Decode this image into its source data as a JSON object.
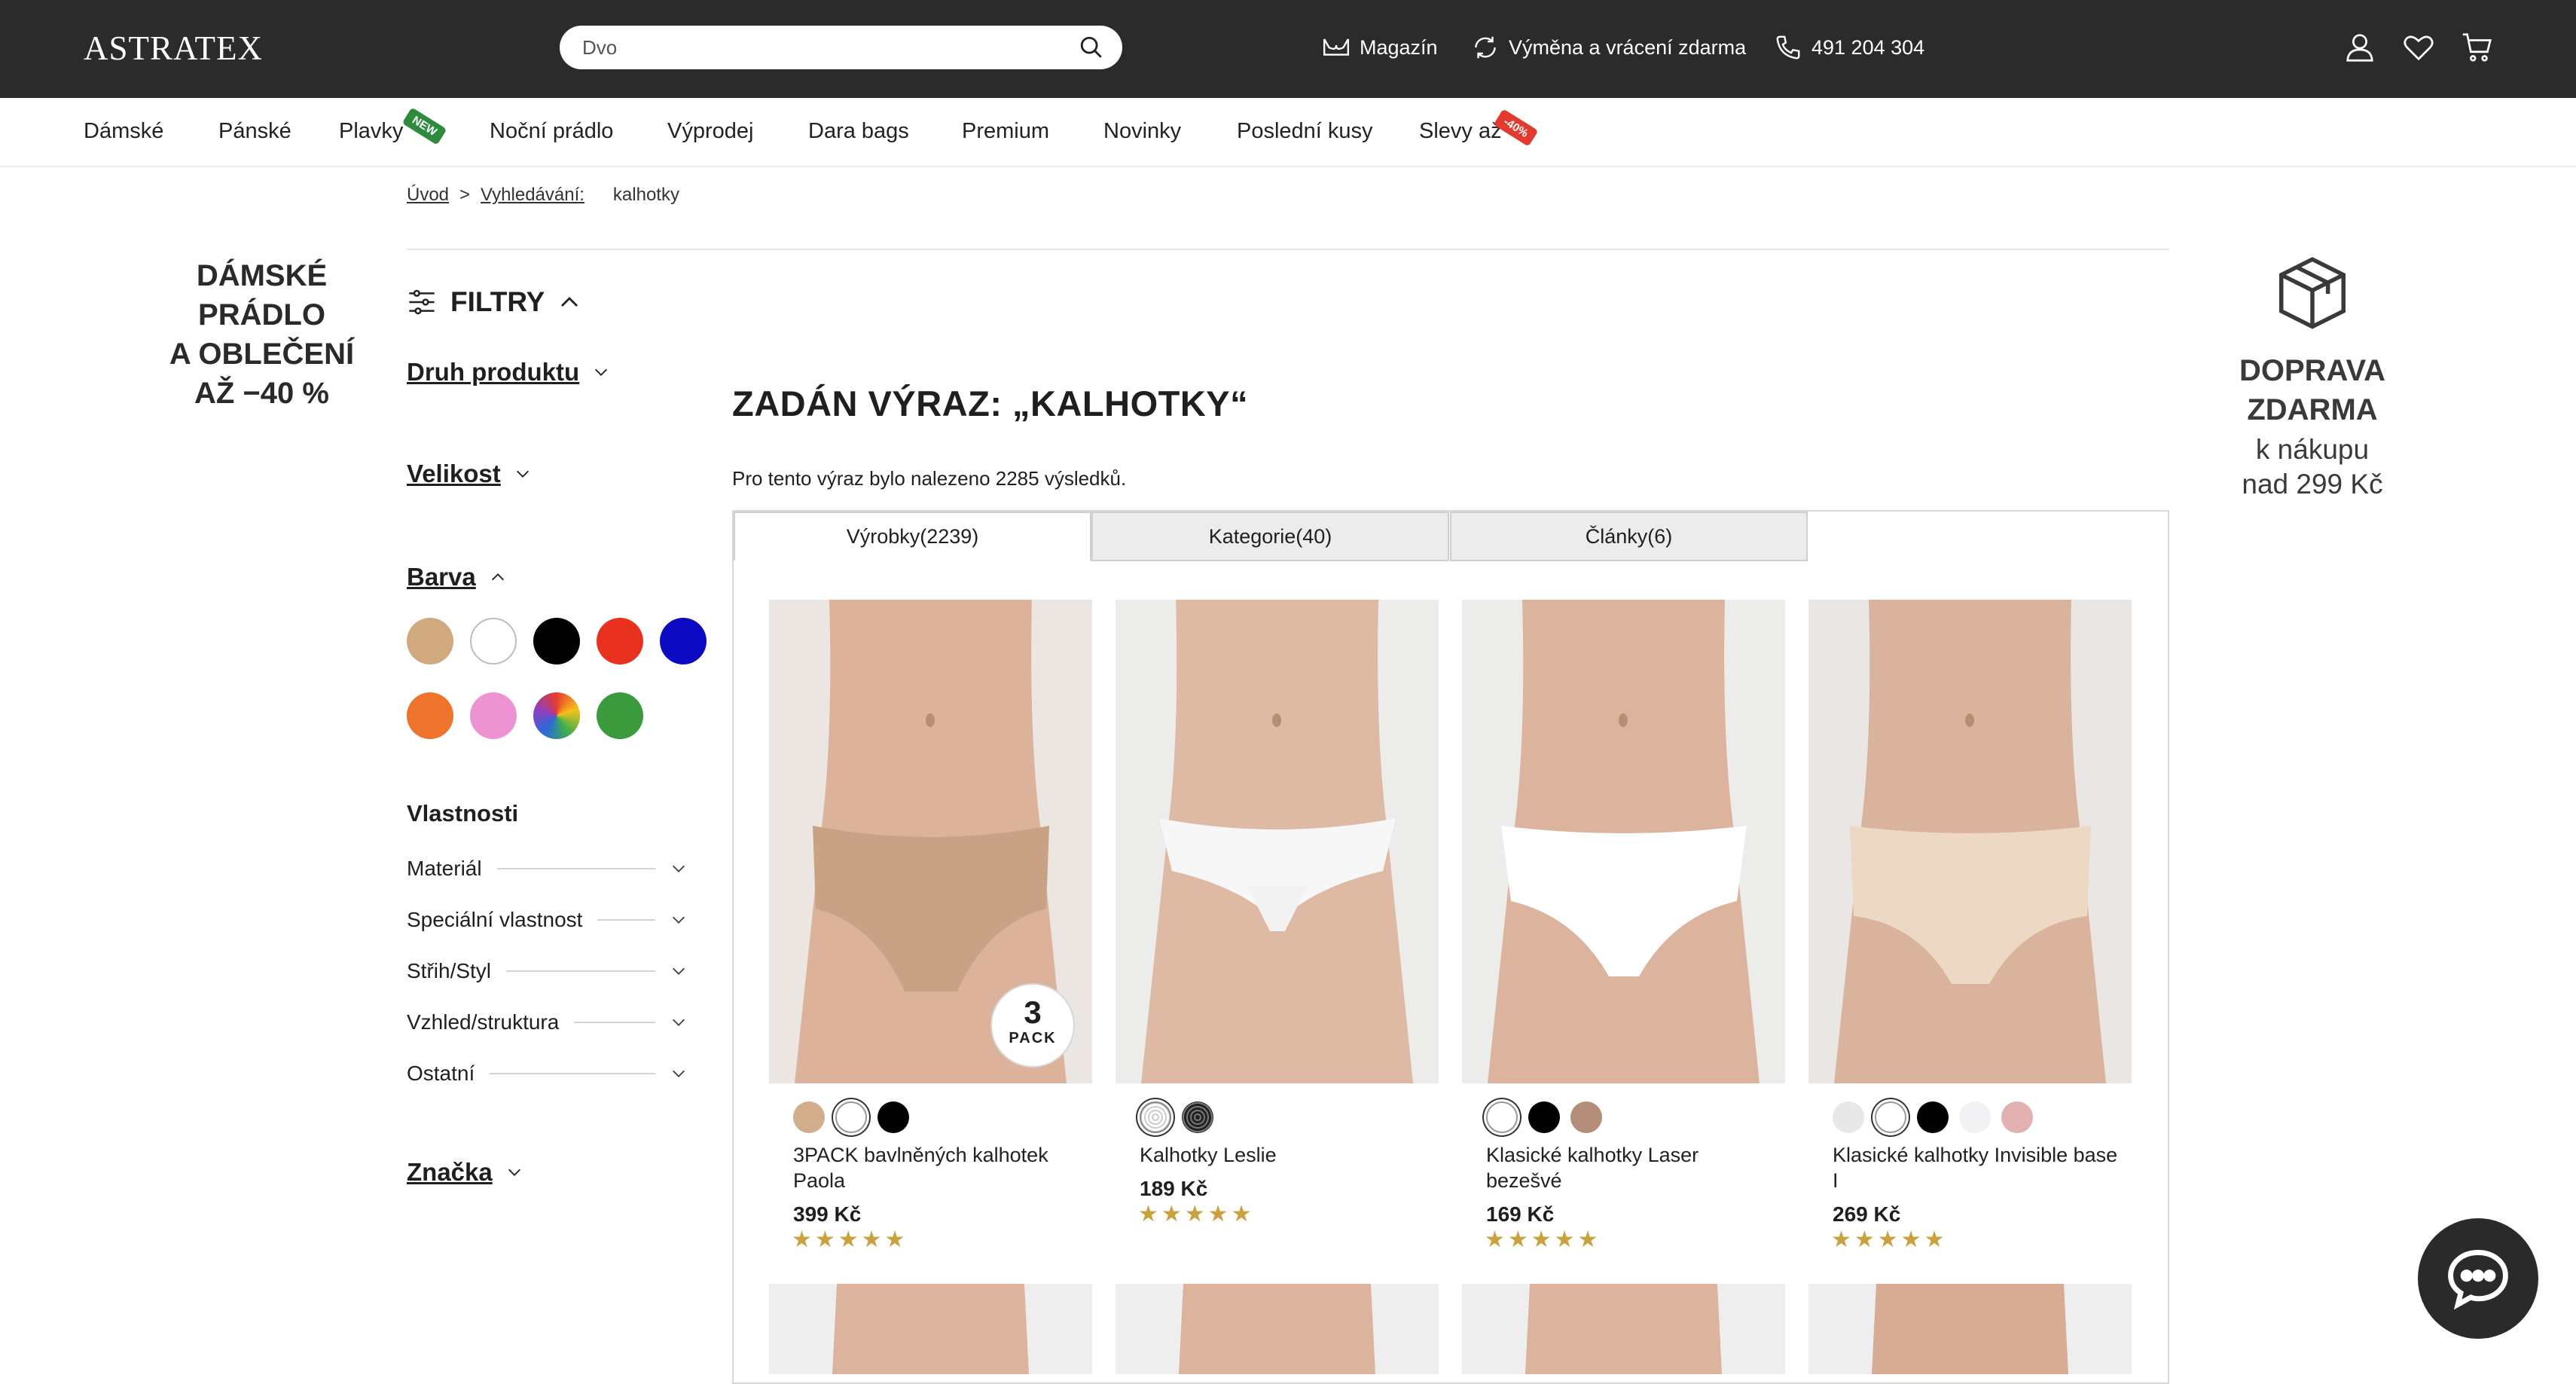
{
  "header": {
    "logo": "ASTRATEX",
    "search": {
      "value": "Dvo"
    },
    "links": [
      {
        "label": "Magazín",
        "icon": "bra-icon"
      },
      {
        "label": "Výměna a vrácení zdarma",
        "icon": "refresh-icon"
      },
      {
        "label": "491 204 304",
        "icon": "phone-icon"
      }
    ],
    "icons": [
      "account-icon",
      "heart-icon",
      "cart-icon"
    ]
  },
  "nav": {
    "items": [
      "Dámské",
      "Pánské",
      "Plavky",
      "Noční prádlo",
      "Výprodej",
      "Dara bags",
      "Premium",
      "Novinky",
      "Poslední kusy",
      "Slevy až"
    ],
    "new_badge": "NEW",
    "sale_badge": "-40%"
  },
  "breadcrumb": {
    "home": "Úvod",
    "sep": ">",
    "search": "Vyhledávání:",
    "current": "kalhotky"
  },
  "promo_left": {
    "lines": [
      "DÁMSKÉ",
      "PRÁDLO",
      "A OBLEČENÍ",
      "AŽ −40 %"
    ]
  },
  "promo_right": {
    "title_1": "DOPRAVA",
    "title_2": "ZDARMA",
    "sub_1": "k nákupu",
    "sub_2": "nad 299 Kč"
  },
  "filters": {
    "title": "FILTRY",
    "product_type": "Druh produktu",
    "size": "Velikost",
    "color": "Barva",
    "colors": [
      "#d1a97e",
      "#ffffff",
      "#000000",
      "#e8321f",
      "#0d0ac4",
      "#ee742d",
      "#ee93d2",
      "multicolor",
      "#3a9a3c"
    ],
    "properties_title": "Vlastnosti",
    "properties": [
      "Materiál",
      "Speciální vlastnost",
      "Střih/Styl",
      "Vzhled/struktura",
      "Ostatní"
    ],
    "brand": "Značka"
  },
  "main": {
    "title": "ZADÁN VÝRAZ: „KALHOTKY“",
    "results_text": "Pro tento výraz bylo nalezeno 2285 výsledků.",
    "tabs": [
      "Výrobky(2239)",
      "Kategorie(40)",
      "Články(6)"
    ],
    "products": [
      {
        "name": "3PACK bavlněných kalhotek Paola",
        "price": "399 Kč",
        "stars": "★★★★★",
        "colors": [
          "#d1ad8c",
          "#ffffff",
          "#000000"
        ],
        "badge_number": "3",
        "badge_text": "PACK"
      },
      {
        "name": "Kalhotky Leslie",
        "price": "189 Kč",
        "stars": "★★★★★",
        "colors": [
          "lace-white",
          "lace-black"
        ]
      },
      {
        "name": "Klasické kalhotky Laser bezešvé",
        "price": "169 Kč",
        "stars": "★★★★★",
        "colors": [
          "#ffffff",
          "#000000",
          "#b48e78"
        ]
      },
      {
        "name": "Klasické kalhotky Invisible base I",
        "price": "269 Kč",
        "stars": "★★★★★",
        "colors": [
          "#e8e8e8",
          "#ffffff",
          "#000000",
          "#f2f2f4",
          "#e2b0b0"
        ]
      }
    ]
  }
}
